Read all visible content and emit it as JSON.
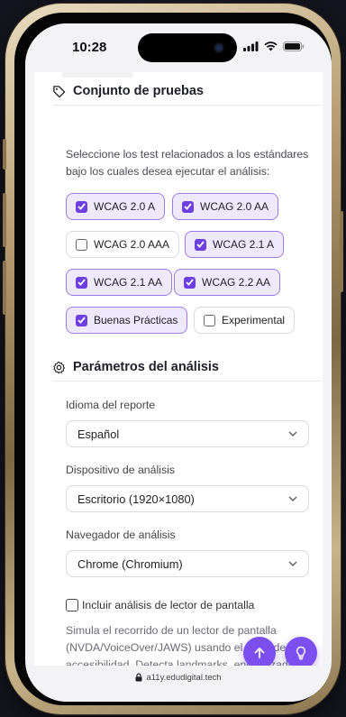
{
  "status_bar": {
    "time": "10:28"
  },
  "test_suite": {
    "title": "Conjunto de pruebas",
    "description": "Seleccione los test relacionados a los estándares bajo los cuales desea ejecutar el análisis:",
    "options": [
      {
        "label": "WCAG 2.0 A",
        "checked": true
      },
      {
        "label": "WCAG 2.0 AA",
        "checked": true
      },
      {
        "label": "WCAG 2.0 AAA",
        "checked": false
      },
      {
        "label": "WCAG 2.1 A",
        "checked": true
      },
      {
        "label": "WCAG 2.1 AA",
        "checked": true
      },
      {
        "label": "WCAG 2.2 AA",
        "checked": true
      },
      {
        "label": "Buenas Prácticas",
        "checked": true
      },
      {
        "label": "Experimental",
        "checked": false
      }
    ]
  },
  "params": {
    "title": "Parámetros del análisis",
    "report_language": {
      "label": "Idioma del reporte",
      "value": "Español"
    },
    "device": {
      "label": "Dispositivo de análisis",
      "value": "Escritorio (1920×1080)"
    },
    "browser": {
      "label": "Navegador de análisis",
      "value": "Chrome (Chromium)"
    },
    "screen_reader": {
      "label": "Incluir análisis de lector de pantalla",
      "checked": false,
      "description": "Simula el recorrido de un lector de pantalla (NVDA/VoiceOver/JAWS) usando el árbol de accesibilidad. Detecta landmarks, encabezados, anuncios, alt text, etiquetas de formulario y orden"
    }
  },
  "fabs": {
    "scroll_top_icon": "arrow-up-icon",
    "tips_icon": "lightbulb-icon"
  },
  "url_bar": {
    "url": "a11y.edudigital.tech"
  },
  "colors": {
    "accent": "#6d3fe0",
    "chip_selected_bg": "#efe9ff",
    "chip_selected_border": "#9b7ae6"
  }
}
